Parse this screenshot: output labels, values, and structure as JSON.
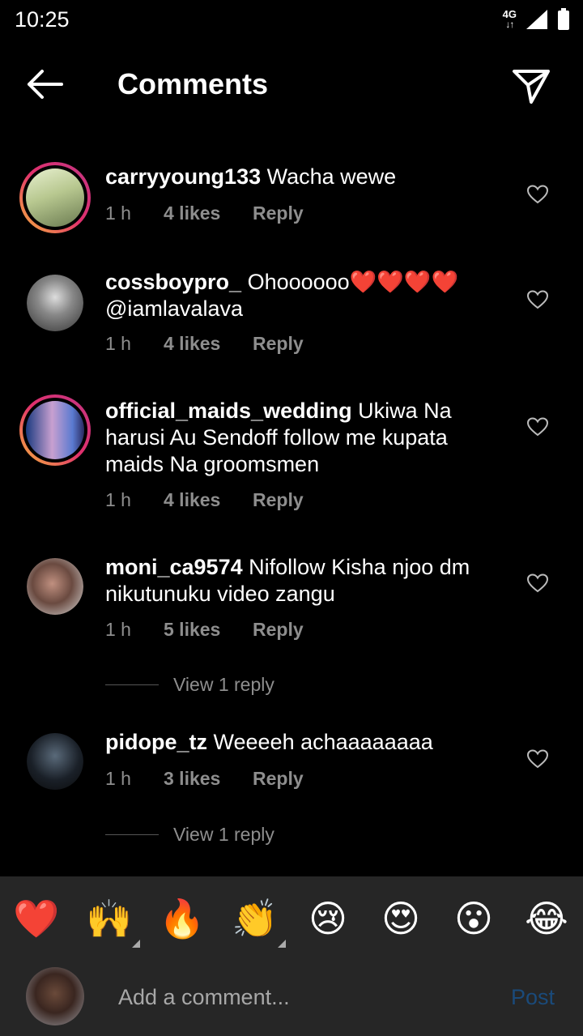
{
  "status": {
    "time": "10:25",
    "network": "4G"
  },
  "header": {
    "title": "Comments"
  },
  "comments": [
    {
      "username": "carryyoung133",
      "text": "Wacha wewe",
      "time": "1 h",
      "likes": "4 likes",
      "reply": "Reply"
    },
    {
      "username": "cossboypro_",
      "text": "Ohoooooo❤️❤️❤️❤️",
      "mention": "@iamlavalava",
      "time": "1 h",
      "likes": "4 likes",
      "reply": "Reply"
    },
    {
      "username": "official_maids_wedding",
      "text": "Ukiwa Na harusi Au Sendoff follow me kupata maids Na groomsmen",
      "time": "1 h",
      "likes": "4 likes",
      "reply": "Reply"
    },
    {
      "username": "moni_ca9574",
      "text": "Nifollow Kisha njoo dm nikutunuku video zangu",
      "time": "1 h",
      "likes": "5 likes",
      "reply": "Reply",
      "view_replies": "View 1 reply"
    },
    {
      "username": "pidope_tz",
      "text": "Weeeeh achaaaaaaaa",
      "time": "1 h",
      "likes": "3 likes",
      "reply": "Reply",
      "view_replies": "View 1 reply"
    }
  ],
  "emoji_bar": [
    "❤️",
    "🙌",
    "🔥",
    "👏",
    "😢",
    "😍",
    "😮",
    "😂"
  ],
  "composer": {
    "placeholder": "Add a comment...",
    "post_label": "Post"
  },
  "colors": {
    "background": "#000000",
    "meta_text": "#8e8e8e",
    "post_disabled": "#1a4a7a",
    "panel": "#262626"
  }
}
